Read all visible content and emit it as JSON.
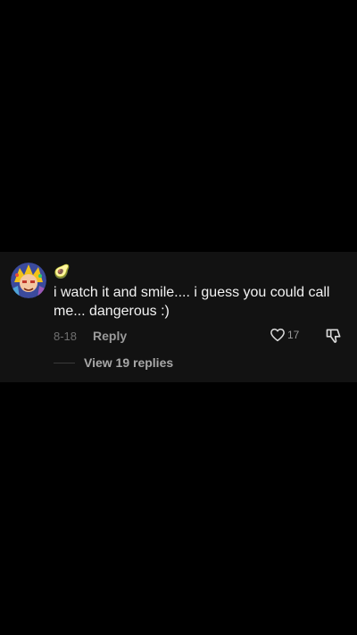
{
  "comment": {
    "username_emoji": "🥑",
    "text": "i watch it and smile.... i guess you could call me... dangerous :)",
    "date": "8-18",
    "reply_label": "Reply",
    "like_count": "17",
    "view_replies_label": "View 19 replies",
    "avatar_icon": "anime-character-avatar",
    "like_icon": "heart-outline-icon",
    "dislike_icon": "thumbs-down-icon"
  },
  "colors": {
    "background": "#000000",
    "card": "#121212",
    "text_primary": "#f2f2f2",
    "text_secondary": "#9a9a9a"
  }
}
